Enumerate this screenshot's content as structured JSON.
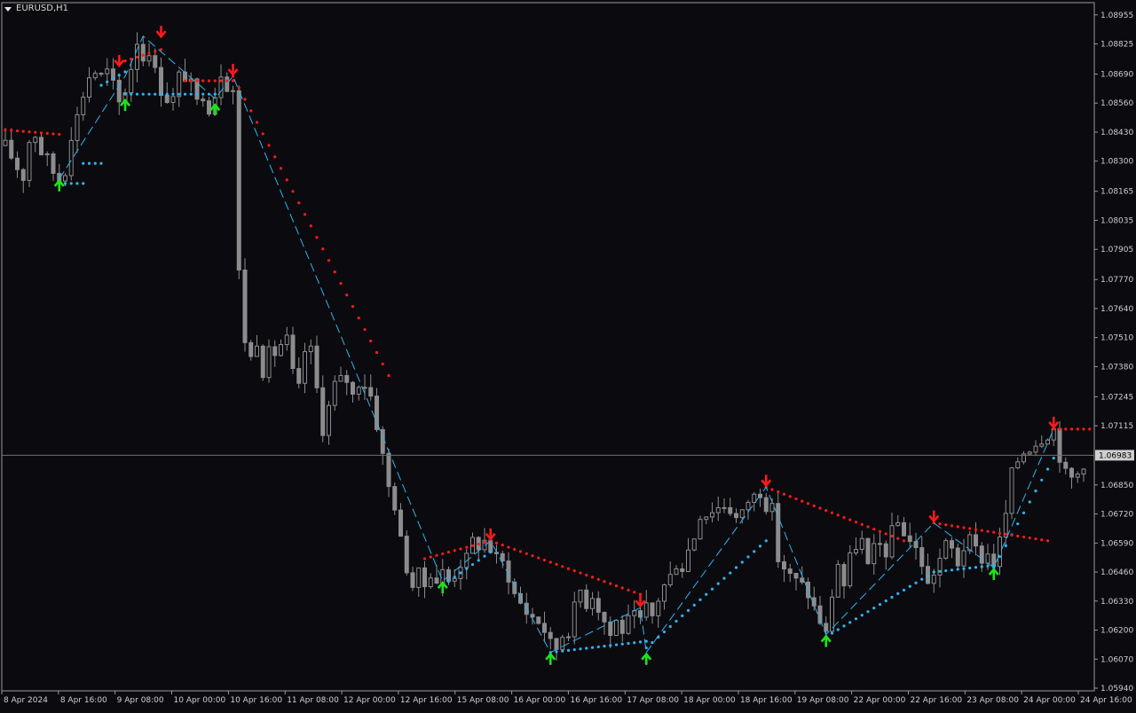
{
  "symbol": "EURUSD,H1",
  "colors": {
    "background": "#0b0b0f",
    "candle": "#8c8c8c",
    "axis": "#cfcfcf",
    "zigzag": "#2fb3f0",
    "support_dots": "#2fb3f0",
    "resistance_dots": "#ff1a1a",
    "up_arrow": "#19e61a",
    "down_arrow": "#ff1a1a",
    "price_line": "#707070"
  },
  "chart_data": {
    "type": "candlestick",
    "price_axis_labels": [
      "1.08955",
      "1.08825",
      "1.08690",
      "1.08560",
      "1.08430",
      "1.08300",
      "1.08165",
      "1.08035",
      "1.07905",
      "1.07770",
      "1.07640",
      "1.07510",
      "1.07380",
      "1.07245",
      "1.07115",
      "1.06850",
      "1.06720",
      "1.06590",
      "1.06460",
      "1.06330",
      "1.06200",
      "1.06070",
      "1.05940"
    ],
    "current_price": "1.06983",
    "time_axis_labels": [
      "8 Apr 2024",
      "8 Apr 16:00",
      "9 Apr 08:00",
      "10 Apr 00:00",
      "10 Apr 16:00",
      "11 Apr 08:00",
      "12 Apr 00:00",
      "12 Apr 16:00",
      "15 Apr 08:00",
      "16 Apr 00:00",
      "16 Apr 16:00",
      "17 Apr 08:00",
      "18 Apr 00:00",
      "18 Apr 16:00",
      "19 Apr 08:00",
      "22 Apr 00:00",
      "22 Apr 16:00",
      "23 Apr 08:00",
      "24 Apr 00:00",
      "24 Apr 16:00"
    ],
    "ylim": [
      1.0594,
      1.0897
    ],
    "close_path": [
      [
        0,
        1.0837
      ],
      [
        1,
        1.0832
      ],
      [
        2,
        1.0827
      ],
      [
        3,
        1.0823
      ],
      [
        4,
        1.0839
      ],
      [
        5,
        1.0842
      ],
      [
        6,
        1.0834
      ],
      [
        7,
        1.0831
      ],
      [
        8,
        1.0825
      ],
      [
        9,
        1.0822
      ],
      [
        10,
        1.0826
      ],
      [
        11,
        1.0842
      ],
      [
        12,
        1.085
      ],
      [
        13,
        1.086
      ],
      [
        14,
        1.0868
      ],
      [
        15,
        1.087
      ],
      [
        16,
        1.0868
      ],
      [
        17,
        1.087
      ],
      [
        18,
        1.0864
      ],
      [
        19,
        1.0856
      ],
      [
        20,
        1.0862
      ],
      [
        21,
        1.0872
      ],
      [
        22,
        1.0884
      ],
      [
        23,
        1.0876
      ],
      [
        24,
        1.088
      ],
      [
        25,
        1.087
      ],
      [
        26,
        1.0862
      ],
      [
        27,
        1.0858
      ],
      [
        28,
        1.0858
      ],
      [
        29,
        1.0868
      ],
      [
        30,
        1.0868
      ],
      [
        31,
        1.0864
      ],
      [
        32,
        1.0856
      ],
      [
        33,
        1.086
      ],
      [
        34,
        1.0854
      ],
      [
        35,
        1.086
      ],
      [
        36,
        1.087
      ],
      [
        37,
        1.0864
      ],
      [
        38,
        1.0862
      ],
      [
        39,
        1.078
      ],
      [
        40,
        1.075
      ],
      [
        41,
        1.0742
      ],
      [
        42,
        1.075
      ],
      [
        43,
        1.0736
      ],
      [
        44,
        1.0744
      ],
      [
        45,
        1.0744
      ],
      [
        46,
        1.0748
      ],
      [
        47,
        1.075
      ],
      [
        48,
        1.0735
      ],
      [
        49,
        1.0728
      ],
      [
        50,
        1.0745
      ],
      [
        51,
        1.0745
      ],
      [
        52,
        1.0728
      ],
      [
        53,
        1.071
      ],
      [
        54,
        1.072
      ],
      [
        55,
        1.073
      ],
      [
        56,
        1.0732
      ],
      [
        57,
        1.0732
      ],
      [
        58,
        1.0725
      ],
      [
        59,
        1.0731
      ],
      [
        60,
        1.073
      ],
      [
        61,
        1.0725
      ],
      [
        62,
        1.0712
      ],
      [
        63,
        1.0698
      ],
      [
        64,
        1.0684
      ],
      [
        65,
        1.0676
      ],
      [
        66,
        1.066
      ],
      [
        67,
        1.0648
      ],
      [
        68,
        1.064
      ],
      [
        69,
        1.0645
      ],
      [
        70,
        1.064
      ],
      [
        71,
        1.0646
      ],
      [
        72,
        1.0642
      ],
      [
        73,
        1.0646
      ],
      [
        74,
        1.0642
      ],
      [
        75,
        1.0645
      ],
      [
        76,
        1.065
      ],
      [
        77,
        1.0652
      ],
      [
        78,
        1.066
      ],
      [
        79,
        1.0658
      ],
      [
        80,
        1.066
      ],
      [
        81,
        1.0656
      ],
      [
        82,
        1.0652
      ],
      [
        83,
        1.065
      ],
      [
        84,
        1.0644
      ],
      [
        85,
        1.0636
      ],
      [
        86,
        1.0632
      ],
      [
        87,
        1.0628
      ],
      [
        88,
        1.0626
      ],
      [
        89,
        1.0624
      ],
      [
        90,
        1.062
      ],
      [
        91,
        1.0614
      ],
      [
        92,
        1.0612
      ],
      [
        93,
        1.0618
      ],
      [
        94,
        1.062
      ],
      [
        95,
        1.063
      ],
      [
        96,
        1.0638
      ],
      [
        97,
        1.0632
      ],
      [
        98,
        1.0636
      ],
      [
        99,
        1.063
      ],
      [
        100,
        1.0624
      ],
      [
        101,
        1.0618
      ],
      [
        102,
        1.0624
      ],
      [
        103,
        1.062
      ],
      [
        104,
        1.0624
      ],
      [
        105,
        1.0626
      ],
      [
        106,
        1.0624
      ],
      [
        107,
        1.063
      ],
      [
        108,
        1.0626
      ],
      [
        109,
        1.0634
      ],
      [
        110,
        1.064
      ],
      [
        111,
        1.0644
      ],
      [
        112,
        1.065
      ],
      [
        113,
        1.0648
      ],
      [
        114,
        1.0656
      ],
      [
        115,
        1.0662
      ],
      [
        116,
        1.0672
      ],
      [
        117,
        1.0672
      ],
      [
        118,
        1.0674
      ],
      [
        119,
        1.0675
      ],
      [
        120,
        1.0676
      ],
      [
        121,
        1.0674
      ],
      [
        122,
        1.067
      ],
      [
        123,
        1.0672
      ],
      [
        124,
        1.0678
      ],
      [
        125,
        1.068
      ],
      [
        126,
        1.0682
      ],
      [
        127,
        1.0676
      ],
      [
        128,
        1.0674
      ],
      [
        129,
        1.0652
      ],
      [
        130,
        1.0648
      ],
      [
        131,
        1.0644
      ],
      [
        132,
        1.0642
      ],
      [
        133,
        1.064
      ],
      [
        134,
        1.0636
      ],
      [
        135,
        1.063
      ],
      [
        136,
        1.0624
      ],
      [
        137,
        1.0618
      ],
      [
        138,
        1.0636
      ],
      [
        139,
        1.065
      ],
      [
        140,
        1.064
      ],
      [
        141,
        1.0652
      ],
      [
        142,
        1.0658
      ],
      [
        143,
        1.066
      ],
      [
        144,
        1.0648
      ],
      [
        145,
        1.0656
      ],
      [
        146,
        1.0658
      ],
      [
        147,
        1.0655
      ],
      [
        148,
        1.0664
      ],
      [
        149,
        1.0668
      ],
      [
        150,
        1.0664
      ],
      [
        151,
        1.066
      ],
      [
        152,
        1.0656
      ],
      [
        153,
        1.065
      ],
      [
        154,
        1.064
      ],
      [
        155,
        1.0646
      ],
      [
        156,
        1.0652
      ],
      [
        157,
        1.0658
      ],
      [
        158,
        1.0656
      ],
      [
        159,
        1.065
      ],
      [
        160,
        1.0657
      ],
      [
        161,
        1.066
      ],
      [
        162,
        1.0656
      ],
      [
        163,
        1.0652
      ],
      [
        164,
        1.0654
      ],
      [
        165,
        1.065
      ],
      [
        166,
        1.066
      ],
      [
        167,
        1.0672
      ],
      [
        168,
        1.069
      ],
      [
        169,
        1.0696
      ],
      [
        170,
        1.07
      ],
      [
        171,
        1.0702
      ],
      [
        172,
        1.0704
      ],
      [
        173,
        1.0706
      ],
      [
        174,
        1.0708
      ],
      [
        175,
        1.071
      ],
      [
        176,
        1.0698
      ],
      [
        177,
        1.069
      ],
      [
        178,
        1.0688
      ],
      [
        179,
        1.069
      ],
      [
        180,
        1.0695
      ]
    ],
    "zigzag": [
      [
        9,
        1.0822
      ],
      [
        20,
        1.0868
      ],
      [
        23,
        1.0886
      ],
      [
        35,
        1.0858
      ],
      [
        38,
        1.0868
      ],
      [
        73,
        1.0642
      ],
      [
        81,
        1.066
      ],
      [
        91,
        1.061
      ],
      [
        106,
        1.063
      ],
      [
        107,
        1.061
      ],
      [
        127,
        1.0684
      ],
      [
        137,
        1.0618
      ],
      [
        155,
        1.0668
      ],
      [
        165,
        1.0648
      ],
      [
        175,
        1.071
      ]
    ],
    "up_arrows": [
      [
        9,
        1.0822
      ],
      [
        20,
        1.0858
      ],
      [
        35,
        1.0856
      ],
      [
        73,
        1.0642
      ],
      [
        91,
        1.061
      ],
      [
        107,
        1.061
      ],
      [
        137,
        1.0618
      ],
      [
        165,
        1.0648
      ]
    ],
    "down_arrows": [
      [
        19,
        1.0872
      ],
      [
        26,
        1.0885
      ],
      [
        38,
        1.0868
      ],
      [
        81,
        1.066
      ],
      [
        106,
        1.063
      ],
      [
        127,
        1.0684
      ],
      [
        155,
        1.0668
      ],
      [
        175,
        1.071
      ]
    ],
    "support_segments": [
      {
        "from": 9,
        "to": 13,
        "start": 1.082,
        "end": 1.082
      },
      {
        "from": 13,
        "to": 16,
        "start": 1.0829,
        "end": 1.0829
      },
      {
        "from": 16,
        "to": 20,
        "start": 1.0864,
        "end": 1.087
      },
      {
        "from": 20,
        "to": 35,
        "start": 1.086,
        "end": 1.086
      },
      {
        "from": 73,
        "to": 81,
        "start": 1.064,
        "end": 1.0655
      },
      {
        "from": 91,
        "to": 107,
        "start": 1.061,
        "end": 1.0615
      },
      {
        "from": 107,
        "to": 127,
        "start": 1.0612,
        "end": 1.066
      },
      {
        "from": 137,
        "to": 155,
        "start": 1.0617,
        "end": 1.0646
      },
      {
        "from": 155,
        "to": 165,
        "start": 1.0646,
        "end": 1.0649
      },
      {
        "from": 165,
        "to": 175,
        "start": 1.0648,
        "end": 1.0697
      }
    ],
    "resistance_segments": [
      {
        "from": 0,
        "to": 9,
        "start": 1.0844,
        "end": 1.0842
      },
      {
        "from": 19,
        "to": 26,
        "start": 1.0874,
        "end": 1.088
      },
      {
        "from": 30,
        "to": 38,
        "start": 1.0866,
        "end": 1.0866
      },
      {
        "from": 38,
        "to": 64,
        "start": 1.0868,
        "end": 1.0734
      },
      {
        "from": 70,
        "to": 81,
        "start": 1.0652,
        "end": 1.066
      },
      {
        "from": 81,
        "to": 106,
        "start": 1.066,
        "end": 1.0636
      },
      {
        "from": 127,
        "to": 150,
        "start": 1.0684,
        "end": 1.066
      },
      {
        "from": 155,
        "to": 174,
        "start": 1.0668,
        "end": 1.066
      },
      {
        "from": 175,
        "to": 181,
        "start": 1.071,
        "end": 1.071
      }
    ]
  }
}
